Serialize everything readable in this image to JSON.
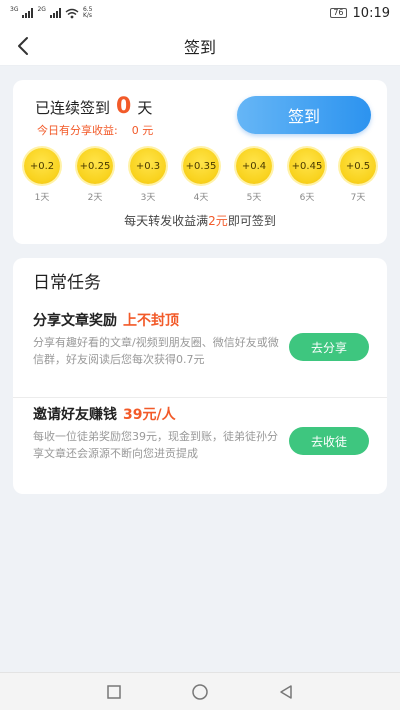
{
  "status_bar": {
    "net1": "3G",
    "net2": "2G",
    "speed_value": "6.5",
    "speed_unit": "K/s",
    "battery": "76",
    "time": "10:19"
  },
  "header": {
    "title": "签到",
    "back_icon": "chevron-left-icon"
  },
  "signin": {
    "streak_label": "已连续签到",
    "streak_count": "0",
    "streak_unit": "天",
    "today_label": "今日有分享收益:",
    "today_value": "0 元",
    "button_label": "签到",
    "coins": [
      {
        "amount": "+0.2",
        "day": "1天"
      },
      {
        "amount": "+0.25",
        "day": "2天"
      },
      {
        "amount": "+0.3",
        "day": "3天"
      },
      {
        "amount": "+0.35",
        "day": "4天"
      },
      {
        "amount": "+0.4",
        "day": "5天"
      },
      {
        "amount": "+0.45",
        "day": "6天"
      },
      {
        "amount": "+0.5",
        "day": "7天"
      }
    ],
    "tip_prefix": "每天转发收益满",
    "tip_amount": "2元",
    "tip_suffix": "即可签到"
  },
  "tasks": {
    "title": "日常任务",
    "items": [
      {
        "name": "分享文章奖励",
        "highlight": "上不封顶",
        "desc": "分享有趣好看的文章/视频到朋友圈、微信好友或微信群，好友阅读后您每次获得0.7元",
        "button": "去分享"
      },
      {
        "name": "邀请好友赚钱",
        "highlight": "39元/人",
        "desc": "每收一位徒弟奖励您39元，现金到账，徒弟徒孙分享文章还会源源不断向您进贡提成",
        "button": "去收徒"
      }
    ]
  },
  "colors": {
    "accent_orange": "#f25a29",
    "signin_blue": "#2c93ef",
    "task_green": "#3ec67f",
    "coin_yellow": "#f9d31f"
  },
  "system_nav": {
    "recent_icon": "square-recent-icon",
    "home_icon": "circle-home-icon",
    "back_icon": "triangle-back-icon"
  }
}
